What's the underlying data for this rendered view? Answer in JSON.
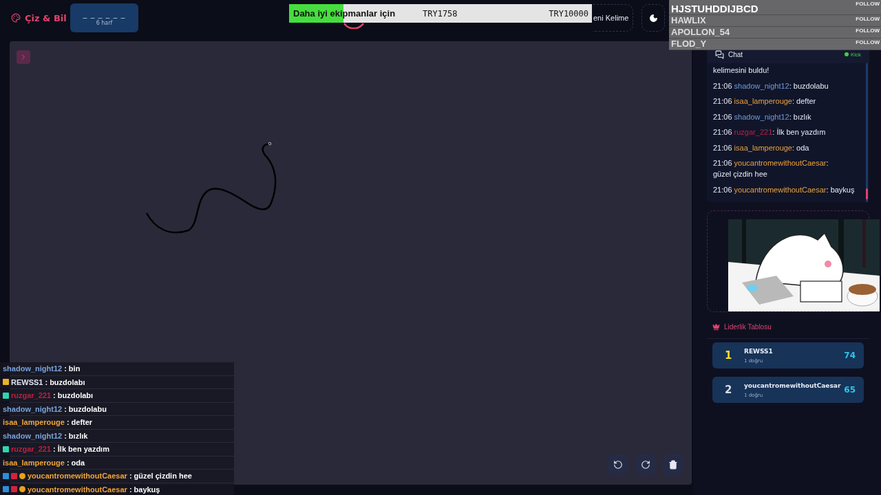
{
  "header": {
    "logo": "Çiz & Bil",
    "word_hint": {
      "blanks": "_ _ _ _ _ _",
      "letters": "6 harf"
    },
    "new_word_button": "eni Kelime"
  },
  "donation_goal": {
    "label": "Daha iyi ekipmanlar için",
    "current": "TRY1758",
    "target": "TRY10000",
    "level": 0.18
  },
  "followers": [
    {
      "name": "HJSTUHDDIJBCD",
      "action": "FOLLOW"
    },
    {
      "name": "HAWLIX",
      "action": "FOLLOW"
    },
    {
      "name": "APOLLON_54",
      "action": "FOLLOW"
    },
    {
      "name": "FLOD_Y",
      "action": "FOLLOW"
    }
  ],
  "chat": {
    "title": "Chat",
    "status": "Kick",
    "separator": ":",
    "messages": [
      {
        "text": "kelimesini buldu!"
      },
      {
        "time": "21:06",
        "user": "shadow_night12",
        "color": "#6f9bd6",
        "text": "buzdolabu"
      },
      {
        "time": "21:06",
        "user": "isaa_lamperouge",
        "color": "#e8a33c",
        "text": "defter"
      },
      {
        "time": "21:06",
        "user": "shadow_night12",
        "color": "#6f9bd6",
        "text": "bızlık"
      },
      {
        "time": "21:06",
        "user": "ruzgar_221",
        "color": "#b3234a",
        "text": "İlk ben yazdım"
      },
      {
        "time": "21:06",
        "user": "isaa_lamperouge",
        "color": "#e8a33c",
        "text": "oda"
      },
      {
        "time": "21:06",
        "user": "youcantromewithoutCaesar",
        "color": "#e8a33c",
        "text": "güzel çizdin hee"
      },
      {
        "time": "21:06",
        "user": "youcantromewithoutCaesar",
        "color": "#e8a33c",
        "text": "baykuş"
      }
    ]
  },
  "leaderboard": {
    "title": "Liderlik Tablosu",
    "entries": [
      {
        "rank": "1",
        "color": "#f5dd2b",
        "name": "REWSS1",
        "detail": "1 doğru",
        "score": "74"
      },
      {
        "rank": "2",
        "color": "#d6dbe6",
        "name": "youcantromewithoutCaesar",
        "detail": "1 doğru",
        "score": "65"
      }
    ]
  },
  "stream_chat": {
    "separator": ":",
    "messages": [
      {
        "user": "shadow_night12",
        "color": "#7aa3dc",
        "text": "bin"
      },
      {
        "badges": [
          {
            "kind": "crown"
          }
        ],
        "user": "REWSS1",
        "color": "#dfe3ee",
        "text": "buzdolabı"
      },
      {
        "badges": [
          {
            "kind": "gift"
          }
        ],
        "user": "ruzgar_221",
        "color": "#c01e43",
        "text": "buzdolabı"
      },
      {
        "user": "shadow_night12",
        "color": "#7aa3dc",
        "text": "buzdolabu"
      },
      {
        "user": "isaa_lamperouge",
        "color": "#f0a53a",
        "text": "defter"
      },
      {
        "user": "shadow_night12",
        "color": "#7aa3dc",
        "text": "bızlık"
      },
      {
        "badges": [
          {
            "kind": "gift"
          }
        ],
        "user": "ruzgar_221",
        "color": "#c01e43",
        "text": "İlk ben yazdım"
      },
      {
        "user": "isaa_lamperouge",
        "color": "#f0a53a",
        "text": "oda"
      },
      {
        "badges": [
          {
            "kind": "tool"
          },
          {
            "kind": "red"
          },
          {
            "kind": "coin"
          }
        ],
        "user": "youcantromewithoutCaesar",
        "color": "#f0a53a",
        "text": "güzel çizdin hee"
      },
      {
        "badges": [
          {
            "kind": "tool"
          },
          {
            "kind": "red"
          },
          {
            "kind": "coin"
          }
        ],
        "user": "youcantromewithoutCaesar",
        "color": "#f0a53a",
        "text": "baykuş"
      }
    ]
  }
}
